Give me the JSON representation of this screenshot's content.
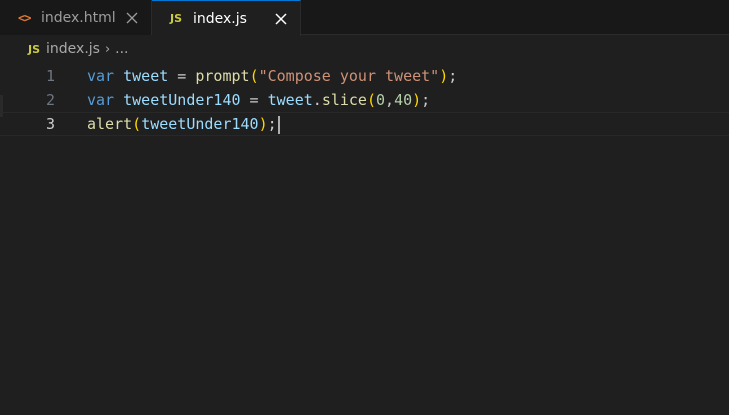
{
  "tabs": [
    {
      "label": "index.html",
      "icon": "html-file-icon",
      "close": "×",
      "active": false
    },
    {
      "label": "index.js",
      "icon": "js-file-icon",
      "close": "×",
      "active": true
    }
  ],
  "breadcrumb": {
    "file": "index.js",
    "separator": "›",
    "more": "..."
  },
  "icons": {
    "html_glyph": "<>",
    "js_glyph": "JS"
  },
  "lines": [
    {
      "number": "1",
      "tokens": [
        {
          "t": "var",
          "c": "kw"
        },
        {
          "t": " ",
          "c": "pun"
        },
        {
          "t": "tweet",
          "c": "var"
        },
        {
          "t": " = ",
          "c": "pun"
        },
        {
          "t": "prompt",
          "c": "fn"
        },
        {
          "t": "(",
          "c": "br1"
        },
        {
          "t": "\"Compose your tweet\"",
          "c": "str"
        },
        {
          "t": ")",
          "c": "br1"
        },
        {
          "t": ";",
          "c": "pun"
        }
      ]
    },
    {
      "number": "2",
      "tokens": [
        {
          "t": "var",
          "c": "kw"
        },
        {
          "t": " ",
          "c": "pun"
        },
        {
          "t": "tweetUnder140",
          "c": "var"
        },
        {
          "t": " = ",
          "c": "pun"
        },
        {
          "t": "tweet",
          "c": "var"
        },
        {
          "t": ".",
          "c": "pun"
        },
        {
          "t": "slice",
          "c": "fn"
        },
        {
          "t": "(",
          "c": "br1"
        },
        {
          "t": "0",
          "c": "num"
        },
        {
          "t": ",",
          "c": "pun"
        },
        {
          "t": "40",
          "c": "num"
        },
        {
          "t": ")",
          "c": "br1"
        },
        {
          "t": ";",
          "c": "pun"
        }
      ]
    },
    {
      "number": "3",
      "current": true,
      "tokens": [
        {
          "t": "alert",
          "c": "fn"
        },
        {
          "t": "(",
          "c": "br1"
        },
        {
          "t": "tweetUnder140",
          "c": "var"
        },
        {
          "t": ")",
          "c": "br1"
        },
        {
          "t": ";",
          "c": "pun"
        }
      ]
    }
  ],
  "colors": {
    "editor_bg": "#1f1f1f",
    "tab_bg": "#181818",
    "active_tab_border": "#0078d4",
    "html_icon": "#e37933",
    "js_icon": "#cbcb41"
  }
}
